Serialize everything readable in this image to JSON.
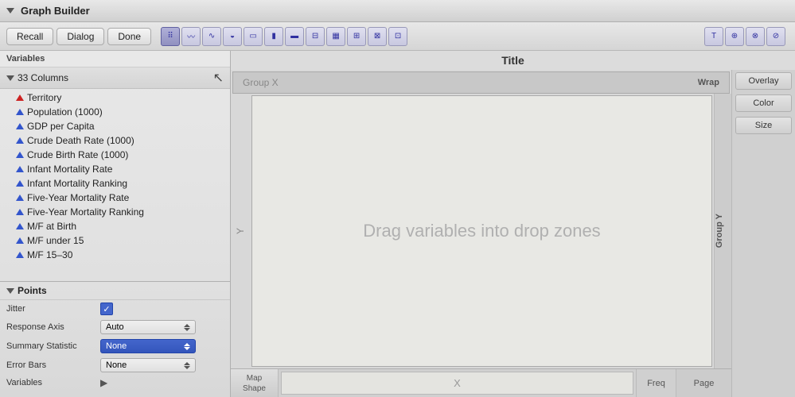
{
  "titleBar": {
    "title": "Graph Builder",
    "collapseArrow": true
  },
  "toolbar": {
    "recallLabel": "Recall",
    "dialogLabel": "Dialog",
    "doneLabel": "Done",
    "chartTypes": [
      {
        "name": "scatter",
        "symbol": "⠿",
        "active": true
      },
      {
        "name": "line",
        "symbol": "〰"
      },
      {
        "name": "smooth",
        "symbol": "∿"
      },
      {
        "name": "pie",
        "symbol": "◒"
      },
      {
        "name": "bar-outline",
        "symbol": "▭"
      },
      {
        "name": "bar",
        "symbol": "▮"
      },
      {
        "name": "histogram",
        "symbol": "▬"
      },
      {
        "name": "box",
        "symbol": "⊟"
      },
      {
        "name": "heat",
        "symbol": "▦"
      },
      {
        "name": "treemap",
        "symbol": "⊞"
      },
      {
        "name": "mosaic",
        "symbol": "⊠"
      },
      {
        "name": "partition",
        "symbol": "⊡"
      }
    ],
    "rightIcons": [
      {
        "name": "text-icon",
        "symbol": "T"
      },
      {
        "name": "globe-icon",
        "symbol": "⊕"
      },
      {
        "name": "local-icon",
        "symbol": "⊗"
      },
      {
        "name": "axes-icon",
        "symbol": "⊘"
      }
    ]
  },
  "variables": {
    "label": "Variables",
    "columns": {
      "header": "33 Columns",
      "items": [
        {
          "name": "Territory",
          "type": "nominal"
        },
        {
          "name": "Population (1000)",
          "type": "continuous"
        },
        {
          "name": "GDP per Capita",
          "type": "continuous"
        },
        {
          "name": "Crude Death Rate (1000)",
          "type": "continuous"
        },
        {
          "name": "Crude Birth Rate (1000)",
          "type": "continuous"
        },
        {
          "name": "Infant Mortality Rate",
          "type": "continuous"
        },
        {
          "name": "Infant Mortality Ranking",
          "type": "continuous"
        },
        {
          "name": "Five-Year Mortality Rate",
          "type": "continuous"
        },
        {
          "name": "Five-Year Mortality Ranking",
          "type": "continuous"
        },
        {
          "name": "M/F at Birth",
          "type": "continuous"
        },
        {
          "name": "M/F under 15",
          "type": "continuous"
        },
        {
          "name": "M/F 15–30",
          "type": "continuous"
        }
      ]
    }
  },
  "points": {
    "header": "Points",
    "jitter": {
      "label": "Jitter",
      "checked": true
    },
    "responseAxis": {
      "label": "Response Axis",
      "value": "Auto"
    },
    "summaryStatistic": {
      "label": "Summary Statistic",
      "value": "None"
    },
    "errorBars": {
      "label": "Error Bars",
      "value": "None"
    },
    "variables": {
      "label": "Variables",
      "hasArrow": true
    }
  },
  "graph": {
    "title": "Title",
    "groupX": "Group X",
    "wrap": "Wrap",
    "overlay": "Overlay",
    "color": "Color",
    "size": "Size",
    "dropZone": "Drag variables into drop zones",
    "yLabel": "Y",
    "groupY": "Group Y",
    "xLabel": "X",
    "freq": "Freq",
    "page": "Page"
  },
  "bottomBar": {
    "mapShape": "Map\nShape"
  }
}
